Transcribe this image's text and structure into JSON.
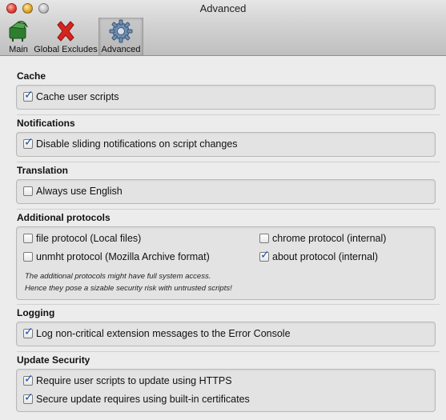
{
  "window": {
    "title": "Advanced"
  },
  "toolbar": {
    "items": [
      {
        "label": "Main",
        "icon": "greasemonkey-main-icon"
      },
      {
        "label": "Global Excludes",
        "icon": "red-x-icon"
      },
      {
        "label": "Advanced",
        "icon": "gear-icon",
        "selected": true
      }
    ]
  },
  "sections": {
    "cache": {
      "title": "Cache",
      "options": [
        {
          "label": "Cache user scripts",
          "checked": true
        }
      ]
    },
    "notifications": {
      "title": "Notifications",
      "options": [
        {
          "label": "Disable sliding notifications on script changes",
          "checked": true
        }
      ]
    },
    "translation": {
      "title": "Translation",
      "options": [
        {
          "label": "Always use English",
          "checked": false
        }
      ]
    },
    "protocols": {
      "title": "Additional protocols",
      "options": [
        {
          "label": "file protocol (Local files)",
          "checked": false
        },
        {
          "label": "chrome protocol (internal)",
          "checked": false
        },
        {
          "label": "unmht protocol (Mozilla Archive format)",
          "checked": false
        },
        {
          "label": "about protocol (internal)",
          "checked": true
        }
      ],
      "note_line1": "The additional protocols might have full system access.",
      "note_line2": "Hence they pose a sizable security risk with untrusted scripts!"
    },
    "logging": {
      "title": "Logging",
      "options": [
        {
          "label": "Log non-critical extension messages to the Error Console",
          "checked": true
        }
      ]
    },
    "update_security": {
      "title": "Update Security",
      "options": [
        {
          "label": "Require user scripts to update using HTTPS",
          "checked": true
        },
        {
          "label": "Secure update requires using built-in certificates",
          "checked": true
        }
      ]
    }
  },
  "colors": {
    "check": "#1a4fb5",
    "window_bg": "#ececec"
  }
}
